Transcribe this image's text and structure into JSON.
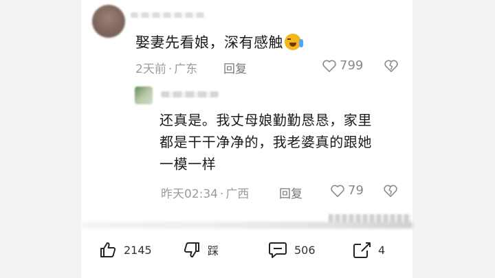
{
  "main_comment": {
    "text": "娶妻先看娘，深有感触",
    "emoji": "crying-face-emoji",
    "time": "2天前",
    "location": "广东",
    "reply_label": "回复",
    "likes": "799"
  },
  "reply_comment": {
    "lines": [
      "还真是。我丈母娘勤勤恳恳，家里",
      "都是干干净净的，我老婆真的跟她",
      "一模一样"
    ],
    "time": "昨天02:34",
    "location": "广西",
    "reply_label": "回复",
    "likes": "79"
  },
  "toolbar": {
    "like_count": "2145",
    "dislike_label": "踩",
    "comment_count": "506",
    "share_count": "4"
  },
  "separator": "·",
  "colors": {
    "meta": "#9b9b9b",
    "text": "#1a1a1a",
    "frame": "#f2f2f2",
    "emoji": "#f5b51b"
  }
}
